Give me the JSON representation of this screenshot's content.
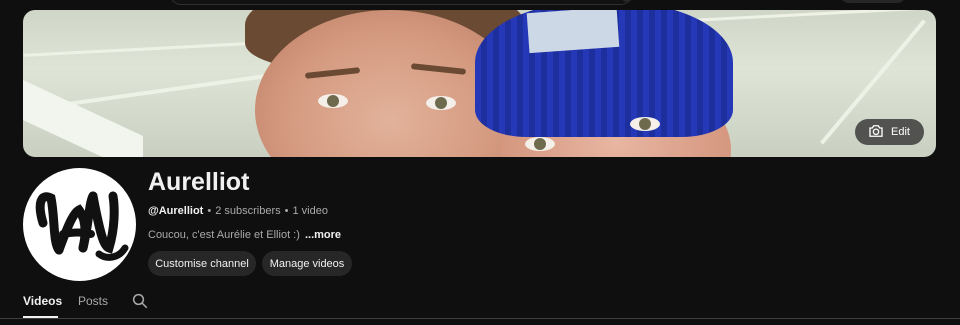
{
  "banner": {
    "edit_label": "Edit"
  },
  "channel": {
    "name": "Aurelliot",
    "handle": "@Aurelliot",
    "subscribers": "2 subscribers",
    "videos": "1 video",
    "separator": "•",
    "description": "Coucou, c'est Aurélie et Elliot :)",
    "more_label": "...more"
  },
  "actions": {
    "customise_label": "Customise channel",
    "manage_label": "Manage videos"
  },
  "tabs": [
    {
      "label": "Videos",
      "selected": true
    },
    {
      "label": "Posts",
      "selected": false
    }
  ],
  "icons": {
    "edit": "camera-icon",
    "tab_search": "search-icon"
  },
  "colors": {
    "background": "#0f0f0f",
    "button": "#272727",
    "text_primary": "#f1f1f1",
    "text_secondary": "#aaaaaa"
  }
}
